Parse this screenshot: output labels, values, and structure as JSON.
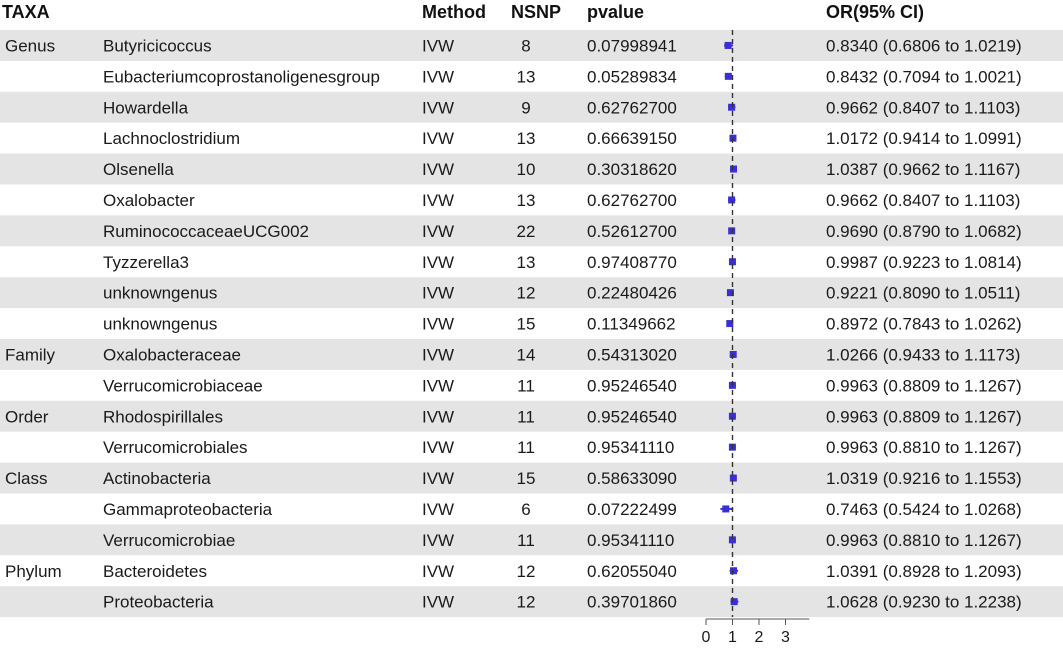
{
  "chart_data": {
    "type": "forest",
    "columns": {
      "taxa": "TAXA",
      "method": "Method",
      "nsnp": "NSNP",
      "pvalue": "pvalue",
      "or_ci": "OR(95% CI)"
    },
    "xaxis": {
      "ticks": [
        0,
        1,
        2,
        3
      ],
      "xlim": [
        0,
        3.3
      ],
      "reference_line": 1
    },
    "colors": {
      "stripe": "#e4e4e4",
      "marker": "#3a2fd6",
      "ci": "#3a2fd6",
      "reference": "#333333"
    },
    "rows": [
      {
        "group": "Genus",
        "taxon": "Butyricicoccus",
        "method": "IVW",
        "nsnp": "8",
        "pvalue": "0.07998941",
        "or_text": "0.8340 (0.6806 to 1.0219)",
        "or": 0.834,
        "lower": 0.6806,
        "upper": 1.0219
      },
      {
        "group": "",
        "taxon": "Eubacteriumcoprostanoligenesgroup",
        "method": "IVW",
        "nsnp": "13",
        "pvalue": "0.05289834",
        "or_text": "0.8432 (0.7094 to 1.0021)",
        "or": 0.8432,
        "lower": 0.7094,
        "upper": 1.0021
      },
      {
        "group": "",
        "taxon": "Howardella",
        "method": "IVW",
        "nsnp": "9",
        "pvalue": "0.62762700",
        "or_text": "0.9662 (0.8407 to 1.1103)",
        "or": 0.9662,
        "lower": 0.8407,
        "upper": 1.1103
      },
      {
        "group": "",
        "taxon": "Lachnoclostridium",
        "method": "IVW",
        "nsnp": "13",
        "pvalue": "0.66639150",
        "or_text": "1.0172 (0.9414 to 1.0991)",
        "or": 1.0172,
        "lower": 0.9414,
        "upper": 1.0991
      },
      {
        "group": "",
        "taxon": "Olsenella",
        "method": "IVW",
        "nsnp": "10",
        "pvalue": "0.30318620",
        "or_text": "1.0387 (0.9662 to 1.1167)",
        "or": 1.0387,
        "lower": 0.9662,
        "upper": 1.1167
      },
      {
        "group": "",
        "taxon": "Oxalobacter",
        "method": "IVW",
        "nsnp": "13",
        "pvalue": "0.62762700",
        "or_text": "0.9662 (0.8407 to 1.1103)",
        "or": 0.9662,
        "lower": 0.8407,
        "upper": 1.1103
      },
      {
        "group": "",
        "taxon": "RuminococcaceaeUCG002",
        "method": "IVW",
        "nsnp": "22",
        "pvalue": "0.52612700",
        "or_text": "0.9690 (0.8790 to 1.0682)",
        "or": 0.969,
        "lower": 0.879,
        "upper": 1.0682
      },
      {
        "group": "",
        "taxon": "Tyzzerella3",
        "method": "IVW",
        "nsnp": "13",
        "pvalue": "0.97408770",
        "or_text": "0.9987 (0.9223 to 1.0814)",
        "or": 0.9987,
        "lower": 0.9223,
        "upper": 1.0814
      },
      {
        "group": "",
        "taxon": "unknowngenus",
        "method": "IVW",
        "nsnp": "12",
        "pvalue": "0.22480426",
        "or_text": "0.9221 (0.8090 to 1.0511)",
        "or": 0.9221,
        "lower": 0.809,
        "upper": 1.0511
      },
      {
        "group": "",
        "taxon": "unknowngenus",
        "method": "IVW",
        "nsnp": "15",
        "pvalue": "0.11349662",
        "or_text": "0.8972 (0.7843 to 1.0262)",
        "or": 0.8972,
        "lower": 0.7843,
        "upper": 1.0262
      },
      {
        "group": "Family",
        "taxon": "Oxalobacteraceae",
        "method": "IVW",
        "nsnp": "14",
        "pvalue": "0.54313020",
        "or_text": "1.0266 (0.9433 to 1.1173)",
        "or": 1.0266,
        "lower": 0.9433,
        "upper": 1.1173
      },
      {
        "group": "",
        "taxon": "Verrucomicrobiaceae",
        "method": "IVW",
        "nsnp": "11",
        "pvalue": "0.95246540",
        "or_text": "0.9963 (0.8809 to 1.1267)",
        "or": 0.9963,
        "lower": 0.8809,
        "upper": 1.1267
      },
      {
        "group": "Order",
        "taxon": "Rhodospirillales",
        "method": "IVW",
        "nsnp": "11",
        "pvalue": "0.95246540",
        "or_text": "0.9963 (0.8809 to 1.1267)",
        "or": 0.9963,
        "lower": 0.8809,
        "upper": 1.1267
      },
      {
        "group": "",
        "taxon": "Verrucomicrobiales",
        "method": "IVW",
        "nsnp": "11",
        "pvalue": "0.95341110",
        "or_text": "0.9963 (0.8810 to 1.1267)",
        "or": 0.9963,
        "lower": 0.881,
        "upper": 1.1267
      },
      {
        "group": "Class",
        "taxon": "Actinobacteria",
        "method": "IVW",
        "nsnp": "15",
        "pvalue": "0.58633090",
        "or_text": "1.0319 (0.9216 to 1.1553)",
        "or": 1.0319,
        "lower": 0.9216,
        "upper": 1.1553
      },
      {
        "group": "",
        "taxon": "Gammaproteobacteria",
        "method": "IVW",
        "nsnp": "6",
        "pvalue": "0.07222499",
        "or_text": "0.7463 (0.5424 to 1.0268)",
        "or": 0.7463,
        "lower": 0.5424,
        "upper": 1.0268
      },
      {
        "group": "",
        "taxon": "Verrucomicrobiae",
        "method": "IVW",
        "nsnp": "11",
        "pvalue": "0.95341110",
        "or_text": "0.9963 (0.8810 to 1.1267)",
        "or": 0.9963,
        "lower": 0.881,
        "upper": 1.1267
      },
      {
        "group": "Phylum",
        "taxon": "Bacteroidetes",
        "method": "IVW",
        "nsnp": "12",
        "pvalue": "0.62055040",
        "or_text": "1.0391 (0.8928 to 1.2093)",
        "or": 1.0391,
        "lower": 0.8928,
        "upper": 1.2093
      },
      {
        "group": "",
        "taxon": "Proteobacteria",
        "method": "IVW",
        "nsnp": "12",
        "pvalue": "0.39701860",
        "or_text": "1.0628 (0.9230 to 1.2238)",
        "or": 1.0628,
        "lower": 0.923,
        "upper": 1.2238
      }
    ]
  }
}
